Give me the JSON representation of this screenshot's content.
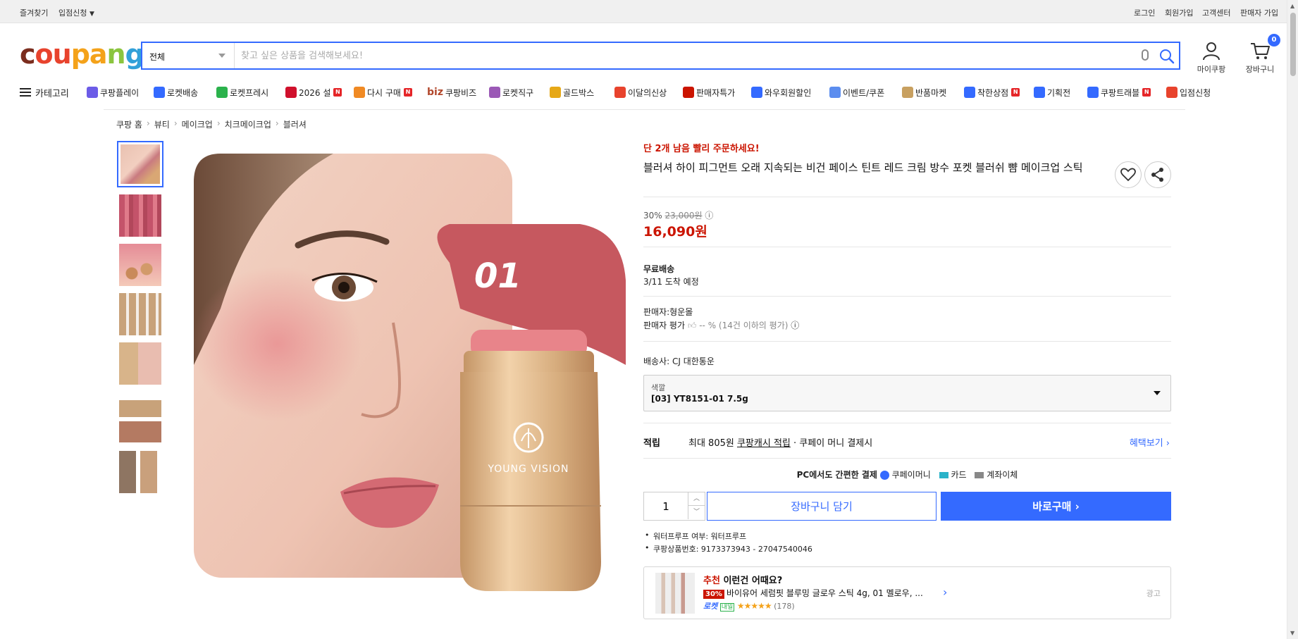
{
  "topbar": {
    "favorites": "즐겨찾기",
    "apply": "입점신청",
    "login": "로그인",
    "signup": "회원가입",
    "support": "고객센터",
    "seller_signup": "판매자 가입"
  },
  "header": {
    "logo_parts": [
      "c",
      "ou",
      "pa",
      "n",
      "g"
    ],
    "search_category": "전체",
    "search_placeholder": "찾고 싶은 상품을 검색해보세요!",
    "my_coupang": "마이쿠팡",
    "cart": "장바구니",
    "cart_count": "0"
  },
  "nav": {
    "category": "카테고리",
    "items": [
      {
        "label": "쿠팡플레이",
        "icon": "play-icon",
        "color": "#6c5ce7"
      },
      {
        "label": "로켓배송",
        "icon": "rocket-icon",
        "color": "#346aff"
      },
      {
        "label": "로켓프레시",
        "icon": "rocket-fresh-icon",
        "color": "#2bb24c"
      },
      {
        "label": "2026 설",
        "icon": "gift-icon",
        "color": "#d0102c",
        "badge": "N"
      },
      {
        "label": "다시 구매",
        "icon": "reorder-icon",
        "color": "#f08a24",
        "badge": "N"
      },
      {
        "label": "쿠팡비즈",
        "icon": "biz-icon",
        "color": "#b2472b",
        "prefix": "biz"
      },
      {
        "label": "로켓직구",
        "icon": "global-icon",
        "color": "#9b59b6"
      },
      {
        "label": "골드박스",
        "icon": "goldbox-icon",
        "color": "#e6a817"
      },
      {
        "label": "이달의신상",
        "icon": "new-icon",
        "color": "#e8432d"
      },
      {
        "label": "판매자특가",
        "icon": "sale-icon",
        "color": "#cb1400"
      },
      {
        "label": "와우회원할인",
        "icon": "wow-icon",
        "color": "#346aff"
      },
      {
        "label": "이벤트/쿠폰",
        "icon": "coupon-icon",
        "color": "#5b8def"
      },
      {
        "label": "반품마켓",
        "icon": "return-icon",
        "color": "#c8a060"
      },
      {
        "label": "착한상점",
        "icon": "shop-icon",
        "color": "#346aff",
        "badge": "N"
      },
      {
        "label": "기획전",
        "icon": "tag-icon",
        "color": "#346aff"
      },
      {
        "label": "쿠팡트래블",
        "icon": "travel-icon",
        "color": "#346aff",
        "badge": "N"
      },
      {
        "label": "입점신청",
        "icon": "store-icon",
        "color": "#e8432d"
      }
    ]
  },
  "breadcrumb": [
    "쿠팡 홈",
    "뷰티",
    "메이크업",
    "치크메이크업",
    "블러셔"
  ],
  "gallery": {
    "product_label": "01",
    "brand_text": "YOUNG VISION",
    "thumbnail_count": 7
  },
  "product": {
    "urgency": "단 2개 남음 빨리 주문하세요!",
    "title": "블러셔 하이 피그먼트 오래 지속되는 비건 페이스 틴트 레드 크림 방수 포켓 블러쉬 뺨 메이크업 스틱",
    "discount_rate": "30%",
    "original_price": "23,000원",
    "price": "16,090원",
    "shipping_label": "무료배송",
    "arrival": "3/11 도착 예정",
    "seller": "판매자:형운몰",
    "seller_rating_label": "판매자 평가",
    "seller_rating_value": "-- % (14건 이하의 평가)",
    "carrier": "배송사:  CJ 대한통운",
    "option_label": "색깔",
    "option_value": "[03] YT8151-01 7.5g",
    "reward_label": "적립",
    "reward_max": "최대 805원",
    "reward_link": "쿠팡캐시 적립",
    "reward_tail": "· 쿠페이 머니 결제시",
    "benefits_link": "혜택보기 ›",
    "pay_title": "PC에서도 간편한 결제",
    "pay_methods": [
      "쿠페이머니",
      "카드",
      "계좌이체"
    ],
    "quantity": "1",
    "add_to_cart": "장바구니 담기",
    "buy_now": "바로구매 ›",
    "details": [
      "워터프루프 여부: 워터프루프",
      "쿠팡상품번호: 9173373943 - 27047540046"
    ]
  },
  "recommend": {
    "title_red": "추천",
    "title_rest": " 이런건 어때요?",
    "discount": "30%",
    "product": "바이유어 세럼핏 블루밍 글로우 스틱 4g, 01 멜로우, ...",
    "rocket": "로켓",
    "tomorrow": "내일",
    "stars": "★★★★★",
    "reviews": "(178)",
    "ad": "광고",
    "rating": 4.5
  }
}
